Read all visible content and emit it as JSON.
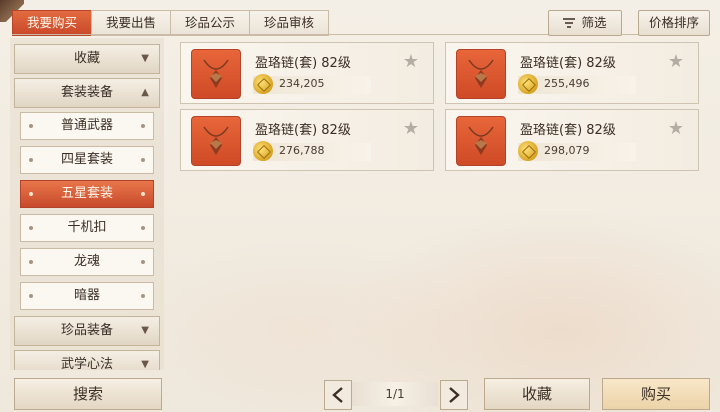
{
  "tabs": [
    "我要购买",
    "我要出售",
    "珍品公示",
    "珍品审核"
  ],
  "toolbar": {
    "filter_label": "筛选",
    "sort_label": "价格排序"
  },
  "sidebar": {
    "categories": [
      {
        "label": "收藏",
        "arrow": "▼"
      },
      {
        "label": "套装装备",
        "arrow": "▲"
      },
      {
        "label": "珍品装备",
        "arrow": "▼"
      },
      {
        "label": "武学心法",
        "arrow": "▼"
      }
    ],
    "items": [
      "普通武器",
      "四星套装",
      "五星套装",
      "千机扣",
      "龙魂",
      "暗器"
    ],
    "active_item": "五星套装"
  },
  "listings": [
    {
      "name": "盈珞链(套) 82级",
      "price": "234,205",
      "icon": "necklace-icon"
    },
    {
      "name": "盈珞链(套) 82级",
      "price": "255,496",
      "icon": "necklace-icon"
    },
    {
      "name": "盈珞链(套) 82级",
      "price": "276,788",
      "icon": "necklace-icon"
    },
    {
      "name": "盈珞链(套) 82级",
      "price": "298,079",
      "icon": "necklace-icon"
    }
  ],
  "star_glyph": "★",
  "bottom": {
    "search_label": "搜索",
    "page_indicator": "1/1",
    "favorite_label": "收藏",
    "buy_label": "购买"
  },
  "colors": {
    "accent": "#d4552f",
    "coin": "#e0ae2a"
  }
}
